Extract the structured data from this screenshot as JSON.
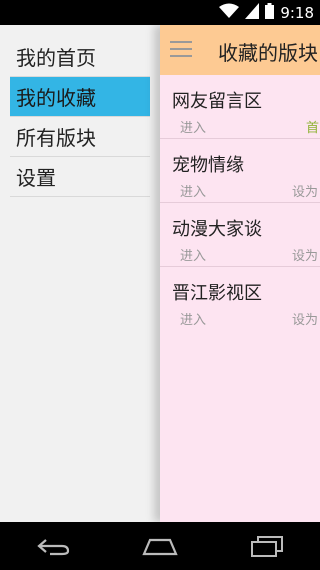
{
  "status": {
    "time": "9:18"
  },
  "drawer": {
    "items": [
      {
        "label": "我的首页",
        "active": false
      },
      {
        "label": "我的收藏",
        "active": true
      },
      {
        "label": "所有版块",
        "active": false
      },
      {
        "label": "设置",
        "active": false
      }
    ]
  },
  "toolbar": {
    "title": "收藏的版块"
  },
  "boards": [
    {
      "name": "网友留言区",
      "enter": "进入",
      "action": "首"
    },
    {
      "name": "宠物情缘",
      "enter": "进入",
      "action": "设为"
    },
    {
      "name": "动漫大家谈",
      "enter": "进入",
      "action": "设为"
    },
    {
      "name": "晋江影视区",
      "enter": "进入",
      "action": "设为"
    }
  ],
  "colors": {
    "accent": "#33b5e5",
    "toolbar": "#fdca93",
    "content_bg": "#fde4f1",
    "drawer_bg": "#f1f1f1"
  }
}
